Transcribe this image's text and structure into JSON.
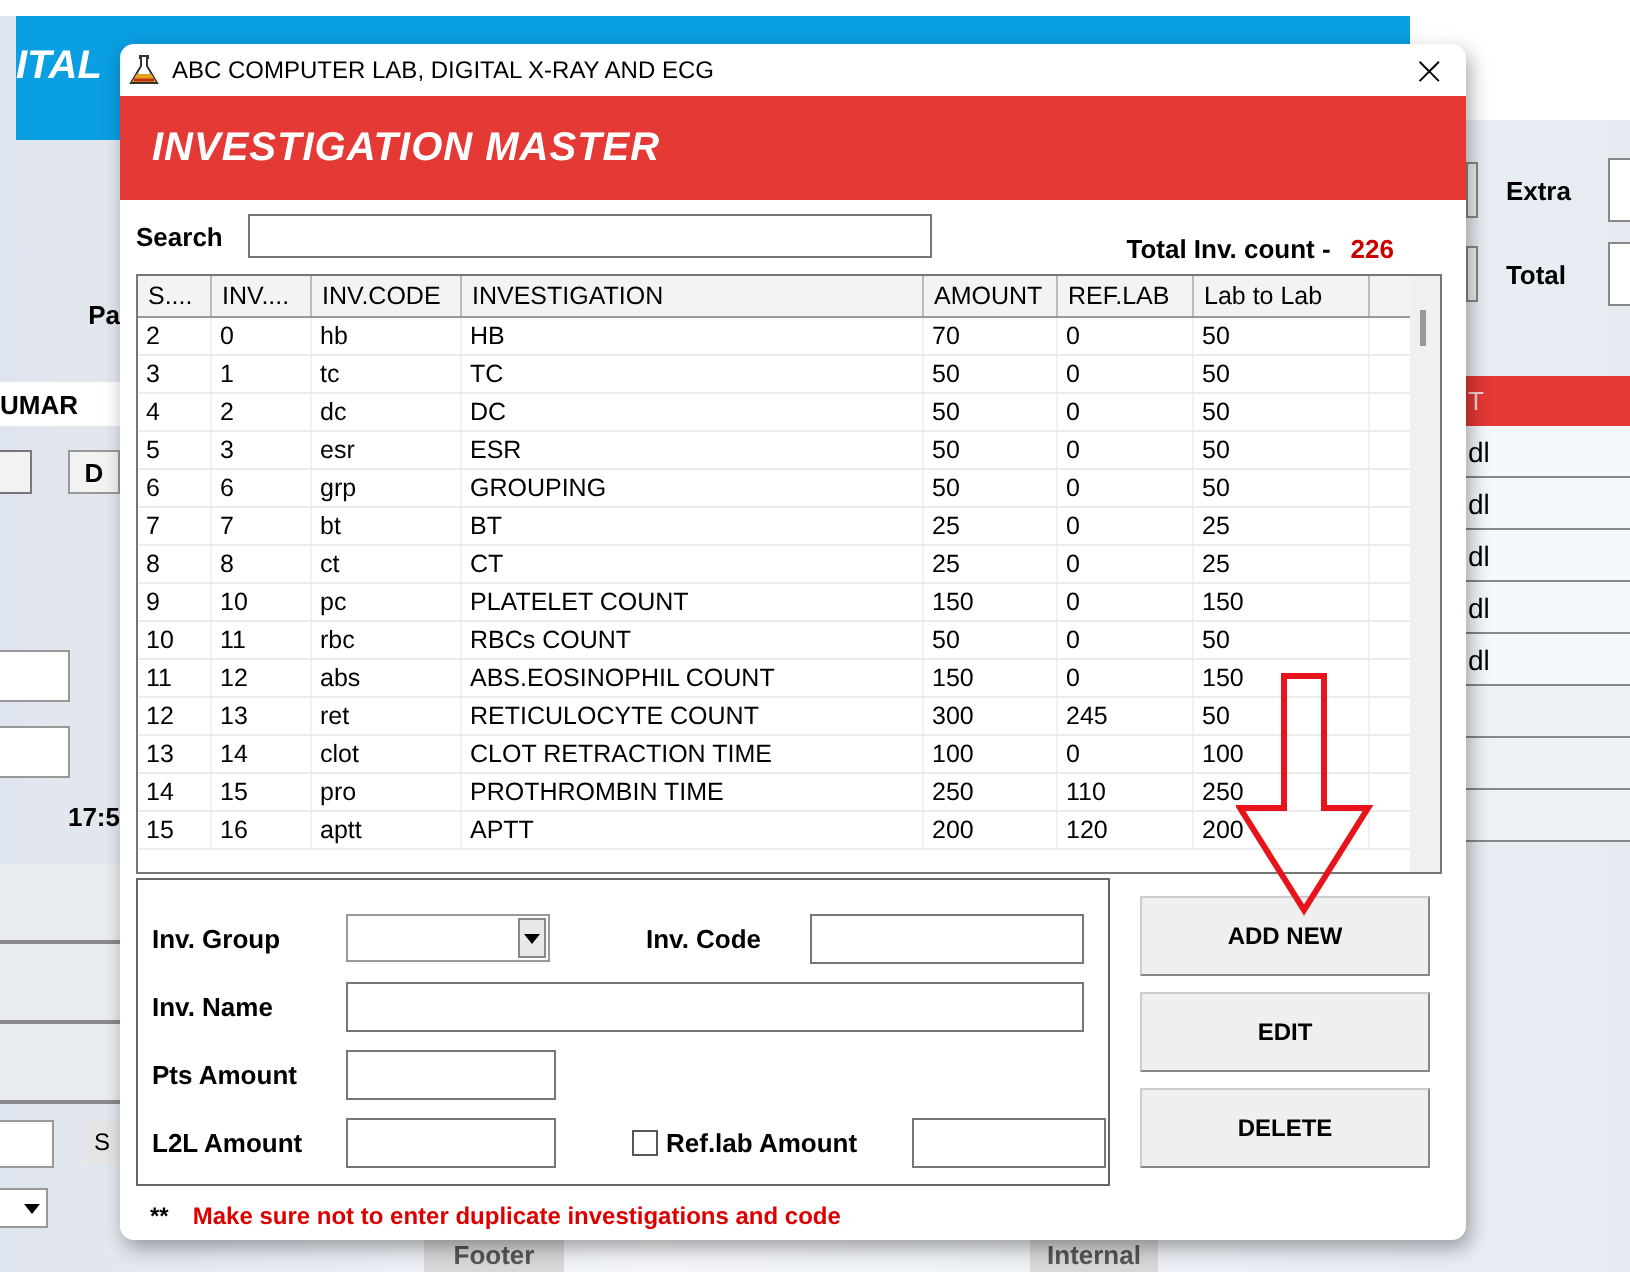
{
  "background": {
    "header_title": "ITAL",
    "left": {
      "label": "Pa",
      "name_value": "UMAR",
      "button": "D",
      "time": "17:5",
      "small_button": "S"
    },
    "right": {
      "extra_label": "Extra",
      "total_label": "Total",
      "table_header": "T",
      "units": [
        "dl",
        "dl",
        "dl",
        "dl",
        "dl"
      ]
    },
    "bottom": {
      "footer_label": "Footer",
      "internal_label": "Internal"
    }
  },
  "dialog": {
    "title": "ABC COMPUTER LAB, DIGITAL X-RAY AND ECG",
    "close": "×",
    "banner": "INVESTIGATION MASTER",
    "search_label": "Search",
    "count_label": "Total Inv. count -",
    "count": "226",
    "table": {
      "columns": [
        "S....",
        "INV....",
        "INV.CODE",
        "INVESTIGATION",
        "AMOUNT",
        "REF.LAB",
        "Lab to Lab"
      ],
      "rows": [
        [
          "2",
          "0",
          "hb",
          "HB",
          "70",
          "0",
          "50"
        ],
        [
          "3",
          "1",
          "tc",
          "TC",
          "50",
          "0",
          "50"
        ],
        [
          "4",
          "2",
          "dc",
          "DC",
          "50",
          "0",
          "50"
        ],
        [
          "5",
          "3",
          "esr",
          "ESR",
          "50",
          "0",
          "50"
        ],
        [
          "6",
          "6",
          "grp",
          "GROUPING",
          "50",
          "0",
          "50"
        ],
        [
          "7",
          "7",
          "bt",
          "BT",
          "25",
          "0",
          "25"
        ],
        [
          "8",
          "8",
          "ct",
          "CT",
          "25",
          "0",
          "25"
        ],
        [
          "9",
          "10",
          "pc",
          "PLATELET COUNT",
          "150",
          "0",
          "150"
        ],
        [
          "10",
          "11",
          "rbc",
          "RBCs COUNT",
          "50",
          "0",
          "50"
        ],
        [
          "11",
          "12",
          "abs",
          "ABS.EOSINOPHIL COUNT",
          "150",
          "0",
          "150"
        ],
        [
          "12",
          "13",
          "ret",
          "RETICULOCYTE COUNT",
          "300",
          "245",
          "50"
        ],
        [
          "13",
          "14",
          "clot",
          "CLOT RETRACTION TIME",
          "100",
          "0",
          "100"
        ],
        [
          "14",
          "15",
          "pro",
          "PROTHROMBIN TIME",
          "250",
          "110",
          "250"
        ],
        [
          "15",
          "16",
          "aptt",
          "APTT",
          "200",
          "120",
          "200"
        ]
      ]
    },
    "form": {
      "group_label": "Inv. Group",
      "code_label": "Inv. Code",
      "name_label": "Inv. Name",
      "pts_label": "Pts Amount",
      "l2l_label": "L2L Amount",
      "ref_label": "Ref.lab Amount",
      "ref_checked": false
    },
    "buttons": [
      "ADD NEW",
      "EDIT",
      "DELETE"
    ],
    "note_mark": "**",
    "note": "Make sure not to enter duplicate investigations and code"
  }
}
